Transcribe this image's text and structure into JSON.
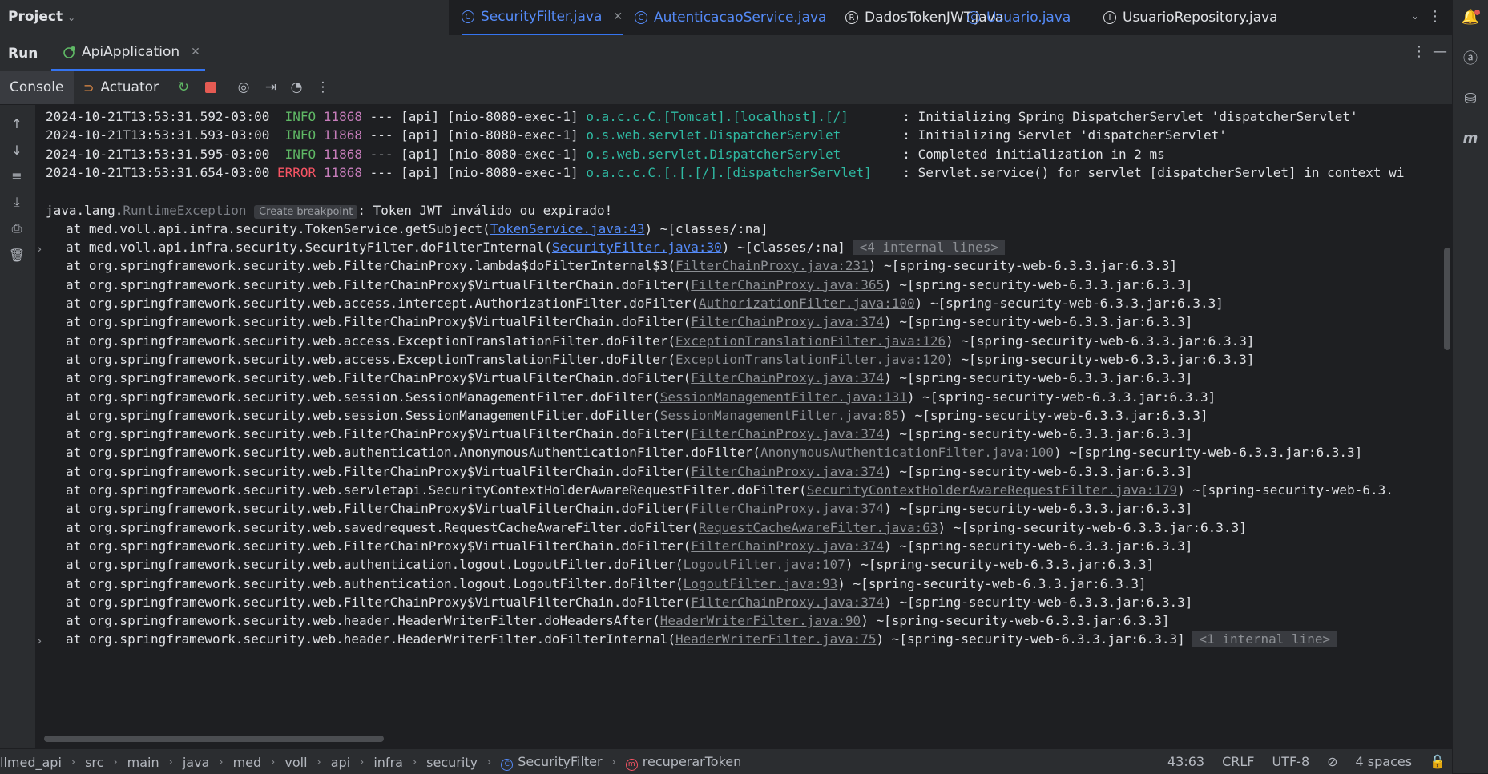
{
  "top": {
    "project_label": "Project",
    "tabs": [
      {
        "icon": "C",
        "label": "SecurityFilter.java",
        "color": "#548af7",
        "active": true,
        "closable": true
      },
      {
        "icon": "C",
        "label": "AutenticacaoService.java",
        "color": "#548af7",
        "active": false,
        "closable": false
      },
      {
        "icon": "R",
        "label": "DadosTokenJWT.java",
        "color": "#dfe1e5",
        "active": false,
        "closable": false
      },
      {
        "icon": "C",
        "label": "Usuario.java",
        "color": "#548af7",
        "active": false,
        "closable": false
      },
      {
        "icon": "I",
        "label": "UsuarioRepository.java",
        "color": "#dfe1e5",
        "active": false,
        "closable": false
      }
    ]
  },
  "run": {
    "label": "Run",
    "config": "ApiApplication"
  },
  "toolbar": {
    "console": "Console",
    "actuator": "Actuator"
  },
  "log": [
    {
      "ts": "2024-10-21T13:53:31.592-03:00",
      "level": "INFO",
      "pid": "11868",
      "thread": "--- [api] [nio-8080-exec-1]",
      "logger": "o.a.c.c.C.[Tomcat].[localhost].[/]      ",
      "msg": ": Initializing Spring DispatcherServlet 'dispatcherServlet'"
    },
    {
      "ts": "2024-10-21T13:53:31.593-03:00",
      "level": "INFO",
      "pid": "11868",
      "thread": "--- [api] [nio-8080-exec-1]",
      "logger": "o.s.web.servlet.DispatcherServlet       ",
      "msg": ": Initializing Servlet 'dispatcherServlet'"
    },
    {
      "ts": "2024-10-21T13:53:31.595-03:00",
      "level": "INFO",
      "pid": "11868",
      "thread": "--- [api] [nio-8080-exec-1]",
      "logger": "o.s.web.servlet.DispatcherServlet       ",
      "msg": ": Completed initialization in 2 ms"
    },
    {
      "ts": "2024-10-21T13:53:31.654-03:00",
      "level": "ERROR",
      "pid": "11868",
      "thread": "--- [api] [nio-8080-exec-1]",
      "logger": "o.a.c.c.C.[.[.[/].[dispatcherServlet]   ",
      "msg": ": Servlet.service() for servlet [dispatcherServlet] in context wi"
    }
  ],
  "exception": {
    "prefix": "java.lang.",
    "class": "RuntimeException",
    "badge": "Create breakpoint",
    "message": ": Token JWT inválido ou expirado!"
  },
  "stack": [
    {
      "pre": "at med.voll.api.infra.security.TokenService.getSubject(",
      "link": "TokenService.java:43",
      "post": ") ~[classes/:na]",
      "primary": true,
      "fold": false,
      "internal": ""
    },
    {
      "pre": "at med.voll.api.infra.security.SecurityFilter.doFilterInternal(",
      "link": "SecurityFilter.java:30",
      "post": ") ~[classes/:na]",
      "primary": true,
      "fold": true,
      "internal": "<4 internal lines>"
    },
    {
      "pre": "at org.springframework.security.web.FilterChainProxy.lambda$doFilterInternal$3(",
      "link": "FilterChainProxy.java:231",
      "post": ") ~[spring-security-web-6.3.3.jar:6.3.3]",
      "primary": false,
      "fold": false,
      "internal": ""
    },
    {
      "pre": "at org.springframework.security.web.FilterChainProxy$VirtualFilterChain.doFilter(",
      "link": "FilterChainProxy.java:365",
      "post": ") ~[spring-security-web-6.3.3.jar:6.3.3]",
      "primary": false,
      "fold": false,
      "internal": ""
    },
    {
      "pre": "at org.springframework.security.web.access.intercept.AuthorizationFilter.doFilter(",
      "link": "AuthorizationFilter.java:100",
      "post": ") ~[spring-security-web-6.3.3.jar:6.3.3]",
      "primary": false,
      "fold": false,
      "internal": ""
    },
    {
      "pre": "at org.springframework.security.web.FilterChainProxy$VirtualFilterChain.doFilter(",
      "link": "FilterChainProxy.java:374",
      "post": ") ~[spring-security-web-6.3.3.jar:6.3.3]",
      "primary": false,
      "fold": false,
      "internal": ""
    },
    {
      "pre": "at org.springframework.security.web.access.ExceptionTranslationFilter.doFilter(",
      "link": "ExceptionTranslationFilter.java:126",
      "post": ") ~[spring-security-web-6.3.3.jar:6.3.3]",
      "primary": false,
      "fold": false,
      "internal": ""
    },
    {
      "pre": "at org.springframework.security.web.access.ExceptionTranslationFilter.doFilter(",
      "link": "ExceptionTranslationFilter.java:120",
      "post": ") ~[spring-security-web-6.3.3.jar:6.3.3]",
      "primary": false,
      "fold": false,
      "internal": ""
    },
    {
      "pre": "at org.springframework.security.web.FilterChainProxy$VirtualFilterChain.doFilter(",
      "link": "FilterChainProxy.java:374",
      "post": ") ~[spring-security-web-6.3.3.jar:6.3.3]",
      "primary": false,
      "fold": false,
      "internal": ""
    },
    {
      "pre": "at org.springframework.security.web.session.SessionManagementFilter.doFilter(",
      "link": "SessionManagementFilter.java:131",
      "post": ") ~[spring-security-web-6.3.3.jar:6.3.3]",
      "primary": false,
      "fold": false,
      "internal": ""
    },
    {
      "pre": "at org.springframework.security.web.session.SessionManagementFilter.doFilter(",
      "link": "SessionManagementFilter.java:85",
      "post": ") ~[spring-security-web-6.3.3.jar:6.3.3]",
      "primary": false,
      "fold": false,
      "internal": ""
    },
    {
      "pre": "at org.springframework.security.web.FilterChainProxy$VirtualFilterChain.doFilter(",
      "link": "FilterChainProxy.java:374",
      "post": ") ~[spring-security-web-6.3.3.jar:6.3.3]",
      "primary": false,
      "fold": false,
      "internal": ""
    },
    {
      "pre": "at org.springframework.security.web.authentication.AnonymousAuthenticationFilter.doFilter(",
      "link": "AnonymousAuthenticationFilter.java:100",
      "post": ") ~[spring-security-web-6.3.3.jar:6.3.3]",
      "primary": false,
      "fold": false,
      "internal": ""
    },
    {
      "pre": "at org.springframework.security.web.FilterChainProxy$VirtualFilterChain.doFilter(",
      "link": "FilterChainProxy.java:374",
      "post": ") ~[spring-security-web-6.3.3.jar:6.3.3]",
      "primary": false,
      "fold": false,
      "internal": ""
    },
    {
      "pre": "at org.springframework.security.web.servletapi.SecurityContextHolderAwareRequestFilter.doFilter(",
      "link": "SecurityContextHolderAwareRequestFilter.java:179",
      "post": ") ~[spring-security-web-6.3.",
      "primary": false,
      "fold": false,
      "internal": ""
    },
    {
      "pre": "at org.springframework.security.web.FilterChainProxy$VirtualFilterChain.doFilter(",
      "link": "FilterChainProxy.java:374",
      "post": ") ~[spring-security-web-6.3.3.jar:6.3.3]",
      "primary": false,
      "fold": false,
      "internal": ""
    },
    {
      "pre": "at org.springframework.security.web.savedrequest.RequestCacheAwareFilter.doFilter(",
      "link": "RequestCacheAwareFilter.java:63",
      "post": ") ~[spring-security-web-6.3.3.jar:6.3.3]",
      "primary": false,
      "fold": false,
      "internal": ""
    },
    {
      "pre": "at org.springframework.security.web.FilterChainProxy$VirtualFilterChain.doFilter(",
      "link": "FilterChainProxy.java:374",
      "post": ") ~[spring-security-web-6.3.3.jar:6.3.3]",
      "primary": false,
      "fold": false,
      "internal": ""
    },
    {
      "pre": "at org.springframework.security.web.authentication.logout.LogoutFilter.doFilter(",
      "link": "LogoutFilter.java:107",
      "post": ") ~[spring-security-web-6.3.3.jar:6.3.3]",
      "primary": false,
      "fold": false,
      "internal": ""
    },
    {
      "pre": "at org.springframework.security.web.authentication.logout.LogoutFilter.doFilter(",
      "link": "LogoutFilter.java:93",
      "post": ") ~[spring-security-web-6.3.3.jar:6.3.3]",
      "primary": false,
      "fold": false,
      "internal": ""
    },
    {
      "pre": "at org.springframework.security.web.FilterChainProxy$VirtualFilterChain.doFilter(",
      "link": "FilterChainProxy.java:374",
      "post": ") ~[spring-security-web-6.3.3.jar:6.3.3]",
      "primary": false,
      "fold": false,
      "internal": ""
    },
    {
      "pre": "at org.springframework.security.web.header.HeaderWriterFilter.doHeadersAfter(",
      "link": "HeaderWriterFilter.java:90",
      "post": ") ~[spring-security-web-6.3.3.jar:6.3.3]",
      "primary": false,
      "fold": false,
      "internal": ""
    },
    {
      "pre": "at org.springframework.security.web.header.HeaderWriterFilter.doFilterInternal(",
      "link": "HeaderWriterFilter.java:75",
      "post": ") ~[spring-security-web-6.3.3.jar:6.3.3]",
      "primary": false,
      "fold": true,
      "internal": "<1 internal line>"
    }
  ],
  "status": {
    "crumbs": [
      "llmed_api",
      "src",
      "main",
      "java",
      "med",
      "voll",
      "api",
      "infra",
      "security",
      "SecurityFilter",
      "recuperarToken"
    ],
    "position": "43:63",
    "line_sep": "CRLF",
    "encoding": "UTF-8",
    "indent": "4 spaces"
  },
  "colors": {
    "accent": "#3574f0",
    "info": "#5fb865",
    "error": "#f75464",
    "logger": "#2fbaa3",
    "link": "#548af7"
  }
}
